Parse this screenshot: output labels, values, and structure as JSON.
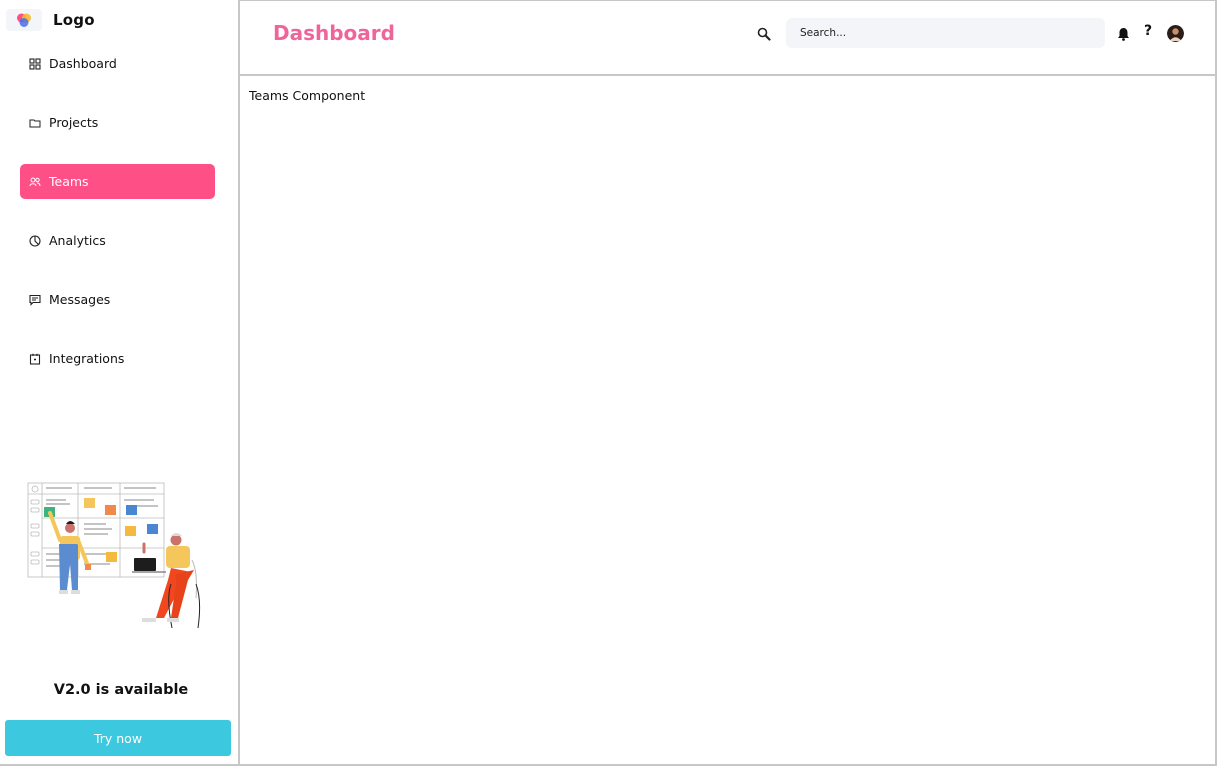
{
  "brand": {
    "logo_text": "Logo"
  },
  "sidebar": {
    "items": [
      {
        "label": "Dashboard",
        "icon": "grid-icon",
        "active": false
      },
      {
        "label": "Projects",
        "icon": "folder-icon",
        "active": false
      },
      {
        "label": "Teams",
        "icon": "users-icon",
        "active": true
      },
      {
        "label": "Analytics",
        "icon": "pie-chart-icon",
        "active": false
      },
      {
        "label": "Messages",
        "icon": "message-icon",
        "active": false
      },
      {
        "label": "Integrations",
        "icon": "calendar-plug-icon",
        "active": false
      }
    ],
    "promo": {
      "title": "V2.0 is available",
      "button_label": "Try now"
    }
  },
  "header": {
    "title": "Dashboard",
    "search": {
      "placeholder": "Search..."
    },
    "help_label": "?"
  },
  "main": {
    "content_text": "Teams Component"
  },
  "colors": {
    "accent_pink": "#ff4f87",
    "title_pink": "#f0649c",
    "button_cyan": "#3cc8df",
    "search_bg": "#f4f5f9",
    "border_gray": "#c7c7c7"
  }
}
